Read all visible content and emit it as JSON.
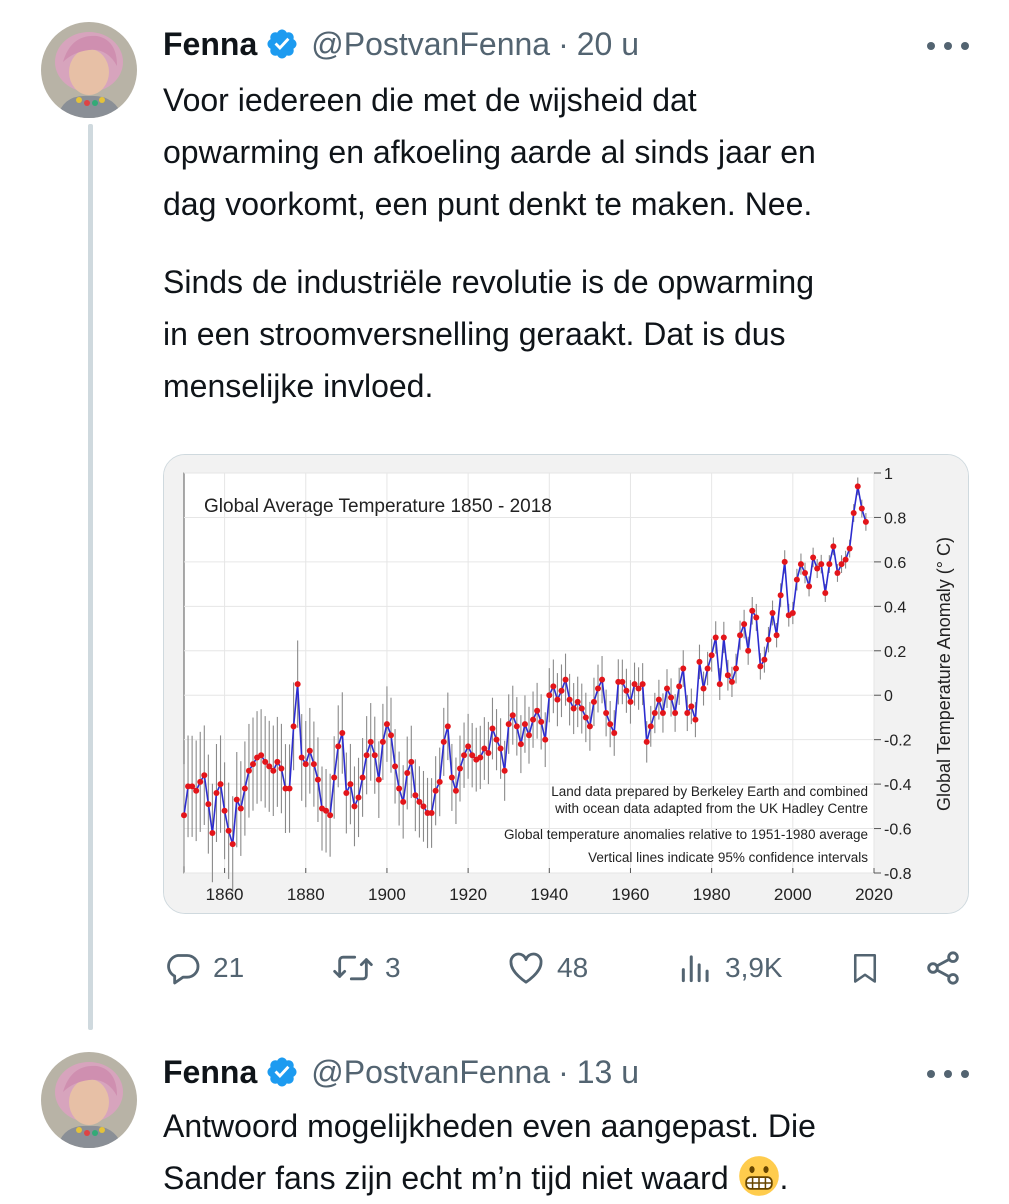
{
  "tweets": [
    {
      "name": "Fenna",
      "handle": "@PostvanFenna",
      "separator": "·",
      "time": "20 u",
      "text": [
        "Voor iedereen die met de wijsheid dat",
        "opwarming en afkoeling aarde al sinds jaar en",
        "dag voorkomt, een punt denkt te maken. Nee.",
        "Sinds de industriële revolutie is de opwarming",
        "in een stroomversnelling geraakt. Dat is dus",
        "menselijke invloed."
      ],
      "stats": {
        "replies": "21",
        "retweets": "3",
        "likes": "48",
        "views": "3,9K"
      }
    },
    {
      "name": "Fenna",
      "handle": "@PostvanFenna",
      "separator": "·",
      "time": "13 u",
      "text": [
        "Antwoord mogelijkheden even aangepast. Die",
        "Sander fans zijn echt m’n tijd niet waard",
        "."
      ]
    }
  ],
  "icons": [
    "verified-badge-icon",
    "more-options-icon",
    "reply-icon",
    "retweet-icon",
    "like-icon",
    "views-icon",
    "bookmark-icon",
    "share-icon",
    "grimacing-face-emoji"
  ],
  "colors": {
    "verified": "#1d9bf0",
    "secondary_text": "#536471",
    "chart_line": "#2c2ccf",
    "chart_point": "#e3151a",
    "chart_errorbar": "#8a8a8a"
  },
  "chart_data": {
    "type": "line",
    "title": "Global Average Temperature 1850 - 2018",
    "ylabel": "Global Temperature Anomaly (° C)",
    "xlabel": "",
    "xlim": [
      1850,
      2020
    ],
    "ylim": [
      -0.8,
      1.0
    ],
    "x_ticks": [
      1860,
      1880,
      1900,
      1920,
      1940,
      1960,
      1980,
      2000,
      2020
    ],
    "y_ticks": [
      -0.8,
      -0.6,
      -0.4,
      -0.2,
      0,
      0.2,
      0.4,
      0.6,
      0.8,
      1
    ],
    "y_tick_labels": [
      "-0.8",
      "-0.6",
      "-0.4",
      "-0.2",
      "0",
      "0.2",
      "0.4",
      "0.6",
      "0.8",
      "1"
    ],
    "grid": true,
    "notes": [
      "Land data prepared by Berkeley Earth and combined",
      "with ocean data adapted from the UK Hadley Centre",
      "Global temperature anomalies relative to 1951-1980 average",
      "Vertical lines indicate 95% confidence intervals"
    ],
    "series": [
      {
        "error_bars": "95% confidence intervals",
        "x": [
          1850,
          1851,
          1852,
          1853,
          1854,
          1855,
          1856,
          1857,
          1858,
          1859,
          1860,
          1861,
          1862,
          1863,
          1864,
          1865,
          1866,
          1867,
          1868,
          1869,
          1870,
          1871,
          1872,
          1873,
          1874,
          1875,
          1876,
          1877,
          1878,
          1879,
          1880,
          1881,
          1882,
          1883,
          1884,
          1885,
          1886,
          1887,
          1888,
          1889,
          1890,
          1891,
          1892,
          1893,
          1894,
          1895,
          1896,
          1897,
          1898,
          1899,
          1900,
          1901,
          1902,
          1903,
          1904,
          1905,
          1906,
          1907,
          1908,
          1909,
          1910,
          1911,
          1912,
          1913,
          1914,
          1915,
          1916,
          1917,
          1918,
          1919,
          1920,
          1921,
          1922,
          1923,
          1924,
          1925,
          1926,
          1927,
          1928,
          1929,
          1930,
          1931,
          1932,
          1933,
          1934,
          1935,
          1936,
          1937,
          1938,
          1939,
          1940,
          1941,
          1942,
          1943,
          1944,
          1945,
          1946,
          1947,
          1948,
          1949,
          1950,
          1951,
          1952,
          1953,
          1954,
          1955,
          1956,
          1957,
          1958,
          1959,
          1960,
          1961,
          1962,
          1963,
          1964,
          1965,
          1966,
          1967,
          1968,
          1969,
          1970,
          1971,
          1972,
          1973,
          1974,
          1975,
          1976,
          1977,
          1978,
          1979,
          1980,
          1981,
          1982,
          1983,
          1984,
          1985,
          1986,
          1987,
          1988,
          1989,
          1990,
          1991,
          1992,
          1993,
          1994,
          1995,
          1996,
          1997,
          1998,
          1999,
          2000,
          2001,
          2002,
          2003,
          2004,
          2005,
          2006,
          2007,
          2008,
          2009,
          2010,
          2011,
          2012,
          2013,
          2014,
          2015,
          2016,
          2017,
          2018
        ],
        "y": [
          -0.54,
          -0.41,
          -0.41,
          -0.43,
          -0.39,
          -0.36,
          -0.49,
          -0.62,
          -0.44,
          -0.4,
          -0.52,
          -0.61,
          -0.67,
          -0.47,
          -0.51,
          -0.42,
          -0.34,
          -0.31,
          -0.28,
          -0.27,
          -0.3,
          -0.32,
          -0.34,
          -0.3,
          -0.33,
          -0.42,
          -0.42,
          -0.14,
          0.05,
          -0.28,
          -0.31,
          -0.25,
          -0.31,
          -0.38,
          -0.51,
          -0.52,
          -0.54,
          -0.37,
          -0.23,
          -0.17,
          -0.44,
          -0.4,
          -0.5,
          -0.46,
          -0.37,
          -0.27,
          -0.21,
          -0.27,
          -0.38,
          -0.21,
          -0.13,
          -0.18,
          -0.32,
          -0.42,
          -0.48,
          -0.35,
          -0.3,
          -0.45,
          -0.48,
          -0.5,
          -0.53,
          -0.53,
          -0.43,
          -0.39,
          -0.21,
          -0.14,
          -0.37,
          -0.43,
          -0.33,
          -0.27,
          -0.23,
          -0.27,
          -0.29,
          -0.28,
          -0.24,
          -0.26,
          -0.15,
          -0.2,
          -0.24,
          -0.34,
          -0.13,
          -0.09,
          -0.14,
          -0.22,
          -0.13,
          -0.18,
          -0.11,
          -0.07,
          -0.12,
          -0.2,
          0.0,
          0.04,
          -0.02,
          0.02,
          0.07,
          -0.02,
          -0.06,
          -0.03,
          -0.06,
          -0.1,
          -0.14,
          -0.03,
          0.03,
          0.07,
          -0.08,
          -0.13,
          -0.17,
          0.06,
          0.06,
          0.02,
          -0.03,
          0.05,
          0.03,
          0.05,
          -0.21,
          -0.14,
          -0.08,
          -0.02,
          -0.08,
          0.03,
          -0.01,
          -0.08,
          0.04,
          0.12,
          -0.08,
          -0.05,
          -0.11,
          0.15,
          0.03,
          0.12,
          0.18,
          0.26,
          0.05,
          0.26,
          0.09,
          0.06,
          0.12,
          0.27,
          0.32,
          0.2,
          0.38,
          0.35,
          0.13,
          0.16,
          0.25,
          0.37,
          0.27,
          0.45,
          0.6,
          0.36,
          0.37,
          0.52,
          0.59,
          0.55,
          0.49,
          0.62,
          0.57,
          0.59,
          0.46,
          0.59,
          0.67,
          0.55,
          0.59,
          0.61,
          0.66,
          0.82,
          0.94,
          0.84,
          0.78
        ]
      }
    ]
  }
}
